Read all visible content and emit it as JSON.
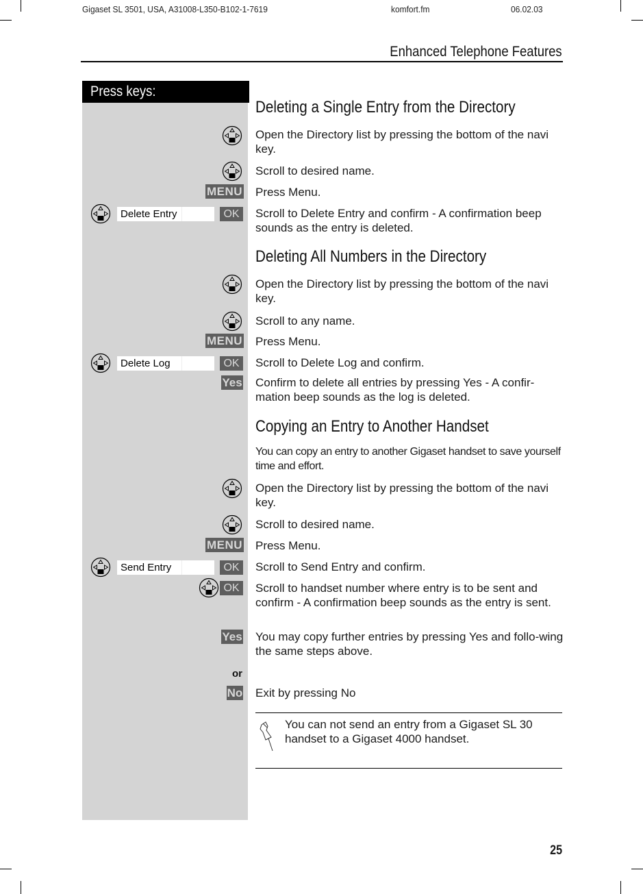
{
  "print_header": {
    "document_id": "Gigaset SL 3501, USA, A31008-L350-B102-1-7619",
    "file_name": "komfort.fm",
    "date": "06.02.03"
  },
  "chapter_title": "Enhanced Telephone Features",
  "keys_column_header": "Press keys:",
  "sections": [
    {
      "title": "Deleting a Single Entry from the Directory",
      "steps": [
        {
          "keys": [
            "navi-key"
          ],
          "text": "Open the Directory list by pressing the bottom of the navi key."
        },
        {
          "keys": [
            "navi-key"
          ],
          "text": "Scroll to desired name."
        },
        {
          "keys": [
            "MENU"
          ],
          "text": "Press Menu."
        },
        {
          "keys": [
            "navi-key",
            "display:Delete Entry",
            "OK"
          ],
          "text": "Scroll to Delete Entry and confirm - A confirmation beep sounds as the entry is deleted."
        }
      ]
    },
    {
      "title": "Deleting All Numbers in the Directory",
      "steps": [
        {
          "keys": [
            "navi-key"
          ],
          "text": "Open the Directory list by pressing the bottom of the navi key."
        },
        {
          "keys": [
            "navi-key"
          ],
          "text": "Scroll to any name."
        },
        {
          "keys": [
            "MENU"
          ],
          "text": "Press Menu."
        },
        {
          "keys": [
            "navi-key",
            "display:Delete Log",
            "OK"
          ],
          "text": "Scroll to Delete Log and confirm."
        },
        {
          "keys": [
            "Yes"
          ],
          "text": "Confirm to delete all entries by pressing Yes - A confir-mation beep sounds as the log is deleted."
        }
      ]
    },
    {
      "title": "Copying an Entry to Another Handset",
      "intro": "You can copy an entry to another Gigaset handset to save yourself time and effort.",
      "steps": [
        {
          "keys": [
            "navi-key"
          ],
          "text": "Open the Directory list by pressing the bottom of the navi key."
        },
        {
          "keys": [
            "navi-key"
          ],
          "text": "Scroll to desired name."
        },
        {
          "keys": [
            "MENU"
          ],
          "text": "Press Menu."
        },
        {
          "keys": [
            "navi-key",
            "display:Send Entry",
            "OK"
          ],
          "text": "Scroll to Send Entry and confirm."
        },
        {
          "keys": [
            "navi-key",
            "OK"
          ],
          "text": "Scroll to handset number where entry is to be sent and confirm - A confirmation beep sounds as the entry is sent."
        },
        {
          "keys": [
            "Yes"
          ],
          "text": "You may copy further entries by pressing Yes and follo-wing the same steps above."
        },
        {
          "keys": [
            "No"
          ],
          "text": "Exit by pressing No"
        }
      ],
      "or_label": "or"
    }
  ],
  "keys": {
    "menu": "MENU",
    "ok": "OK",
    "yes": "Yes",
    "no": "No"
  },
  "displays": {
    "delete_entry": "Delete Entry",
    "delete_log": "Delete Log",
    "send_entry": "Send Entry"
  },
  "note": "You can not send an entry from a Gigaset SL 30 handset to a Gigaset  4000 handset.",
  "page_number": "25"
}
